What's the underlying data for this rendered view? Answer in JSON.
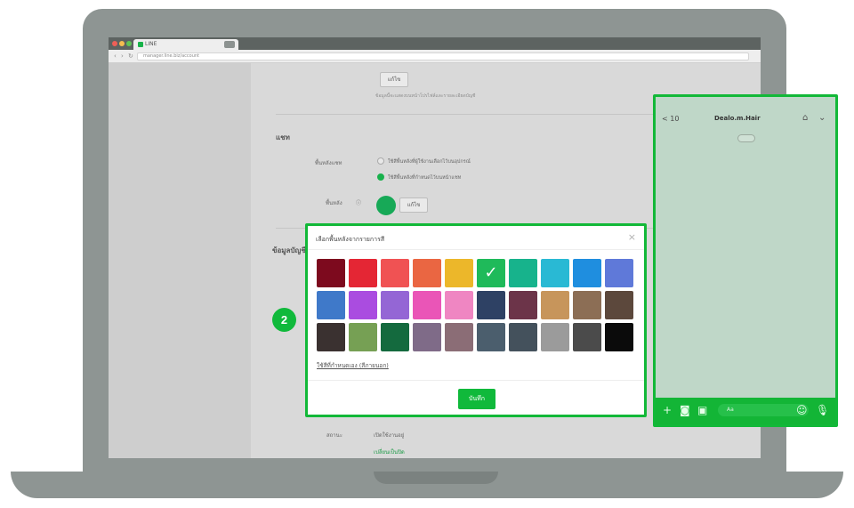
{
  "browser": {
    "tab_title": "LINE",
    "url": "manager.line.biz/account"
  },
  "page": {
    "edit_button_label": "แก้ไข",
    "edit_hint": "ข้อมูลนี้จะแสดงบนหน้าโปรไฟล์และรายละเอียดบัญชี",
    "section_chat_title": "แชท",
    "chat_style_label": "พื้นหลังแชท",
    "option_default": "ใช้สีพื้นหลังที่ผู้ใช้งานเลือกไว้บนอุปกรณ์",
    "option_custom": "ใช้สีพื้นหลังที่กำหนดไว้บนหน้าแชท",
    "color_label": "พื้นหลัง",
    "info_icon": "info-icon",
    "color_edit_label": "แก้ไข",
    "section_profile_title": "ข้อมูลบัญชี",
    "bottom_label": "สถานะ",
    "bottom_value": "เปิดใช้งานอยู่",
    "bottom_link": "เปลี่ยนเป็นปิด"
  },
  "step_marker": "2",
  "dialog": {
    "title": "เลือกพื้นหลังจากรายการสี",
    "close_icon": "close-icon",
    "custom_color_link": "ใช้สีที่กำหนดเอง (สีภายนอก)",
    "save_label": "บันทึก",
    "selected_index": 5,
    "colors": [
      "#7d0a1e",
      "#e42634",
      "#f05253",
      "#ea6642",
      "#ecb72a",
      "#1fba5a",
      "#17b38c",
      "#29b9d4",
      "#1f8edf",
      "#5f79d9",
      "#3f79c9",
      "#aa4ce0",
      "#9466d5",
      "#ea55b7",
      "#ef86c2",
      "#2e4164",
      "#6c3449",
      "#c7955b",
      "#8c6e55",
      "#5c483c",
      "#3a3130",
      "#76a054",
      "#146a3e",
      "#7f6b88",
      "#8b6d76",
      "#4b5e6d",
      "#44515c",
      "#9b9b9b",
      "#4b4b4b",
      "#0b0b0b"
    ]
  },
  "chat_preview": {
    "back_label": "< 10",
    "account_name": "Dealo.m.Hair",
    "home_icon": "home-icon",
    "chevron_icon": "chevron-down-icon",
    "input_placeholder": "Aa",
    "background_color": "#bfd7c8",
    "bar_color": "#13b536"
  }
}
